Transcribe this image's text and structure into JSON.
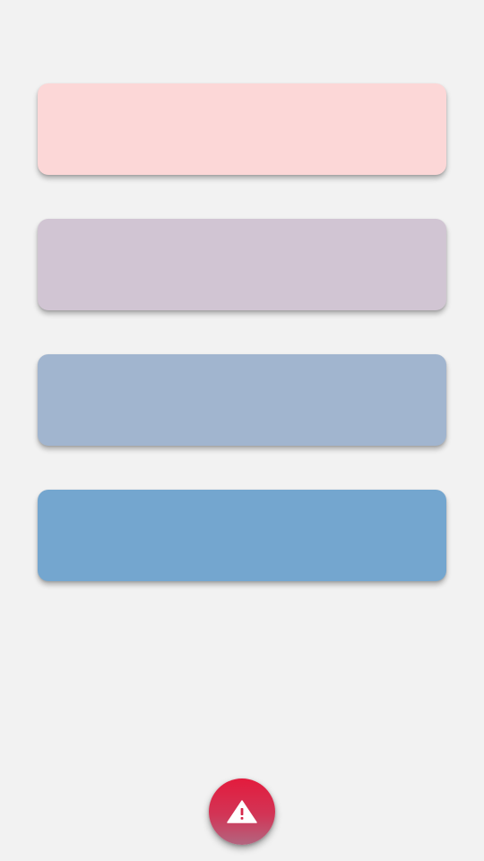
{
  "cards": [
    {
      "color": "#fcd7d7"
    },
    {
      "color": "#d1c5d3"
    },
    {
      "color": "#a1b5cf"
    },
    {
      "color": "#74a6cf"
    }
  ],
  "fab": {
    "icon": "warning-icon",
    "colors": {
      "top": "#e31b3d",
      "bottom": "#b26680"
    }
  },
  "background_color": "#f2f2f2"
}
